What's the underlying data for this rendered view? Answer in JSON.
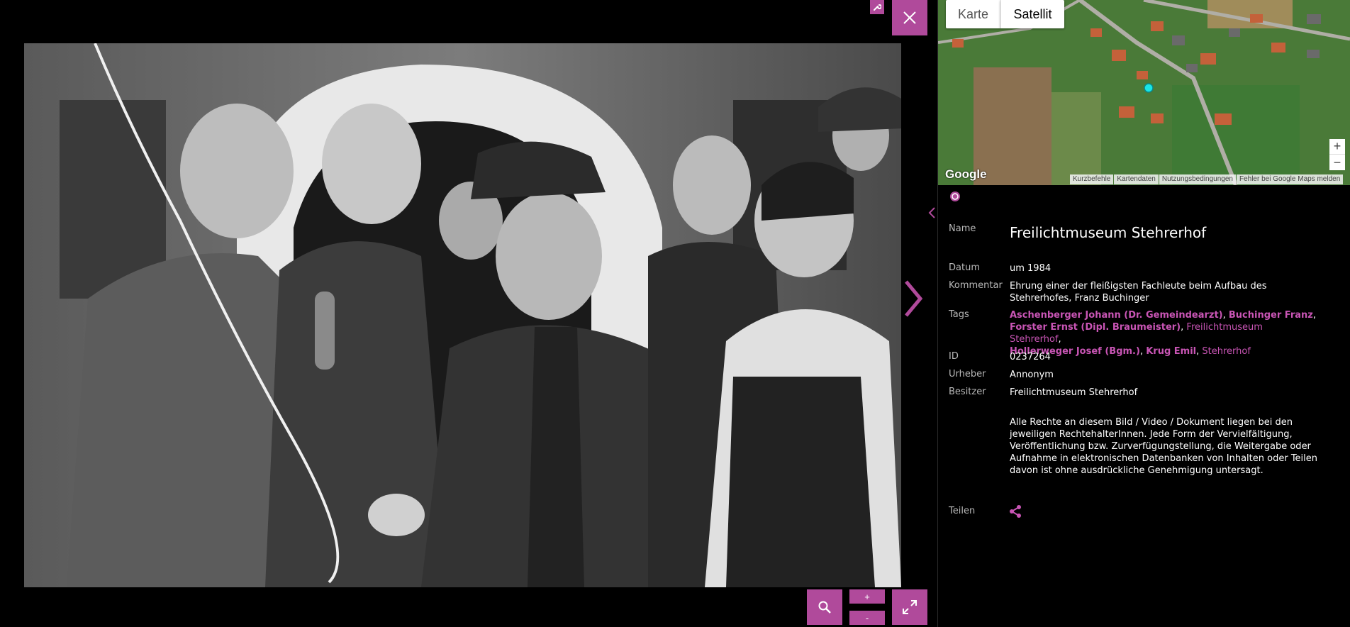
{
  "viewer": {
    "zoom_in_label": "+",
    "zoom_out_label": "-"
  },
  "map": {
    "type_karte": "Karte",
    "type_satellit": "Satellit",
    "zoom_in_label": "+",
    "zoom_out_label": "−",
    "logo_text": "Google",
    "footer_links": [
      "Kurzbefehle",
      "Kartendaten",
      "Nutzungsbedingungen",
      "Fehler bei Google Maps melden"
    ]
  },
  "details": {
    "name_label": "Name",
    "name_value": "Freilichtmuseum Stehrerhof",
    "date_label": "Datum",
    "date_value": "um 1984",
    "comment_label": "Kommentar",
    "comment_value": "Ehrung einer der fleißigsten Fachleute beim Aufbau des Stehrerhofes, Franz Buchinger",
    "tags_label": "Tags",
    "tags": [
      {
        "text": "Aschenberger Johann (Dr. Gemeindearzt)",
        "bold": true
      },
      {
        "text": "Buchinger Franz",
        "bold": true
      },
      {
        "text": "Forster Ernst (Dipl. Braumeister)",
        "bold": true
      },
      {
        "text": "Freilichtmuseum Stehrerhof",
        "bold": false
      },
      {
        "text": "Hollerweger Josef (Bgm.)",
        "bold": true
      },
      {
        "text": "Krug Emil",
        "bold": true
      },
      {
        "text": "Stehrerhof",
        "bold": false
      }
    ],
    "id_label": "ID",
    "id_value": "0237264",
    "author_label": "Urheber",
    "author_value": "Annonym",
    "owner_label": "Besitzer",
    "owner_value": "Freilichtmuseum Stehrerhof",
    "rights_text": "Alle Rechte an diesem Bild / Video / Dokument liegen bei den jeweiligen RechtehalterInnen. Jede Form der Vervielfältigung, Veröffentlichung bzw. Zurverfügungstellung, die Weitergabe oder Aufnahme in elektronischen Datenbanken von Inhalten oder Teilen davon ist ohne ausdrückliche Genehmigung untersagt.",
    "share_label": "Teilen"
  },
  "colors": {
    "accent": "#b04a9b",
    "tag_link": "#c955b5"
  }
}
